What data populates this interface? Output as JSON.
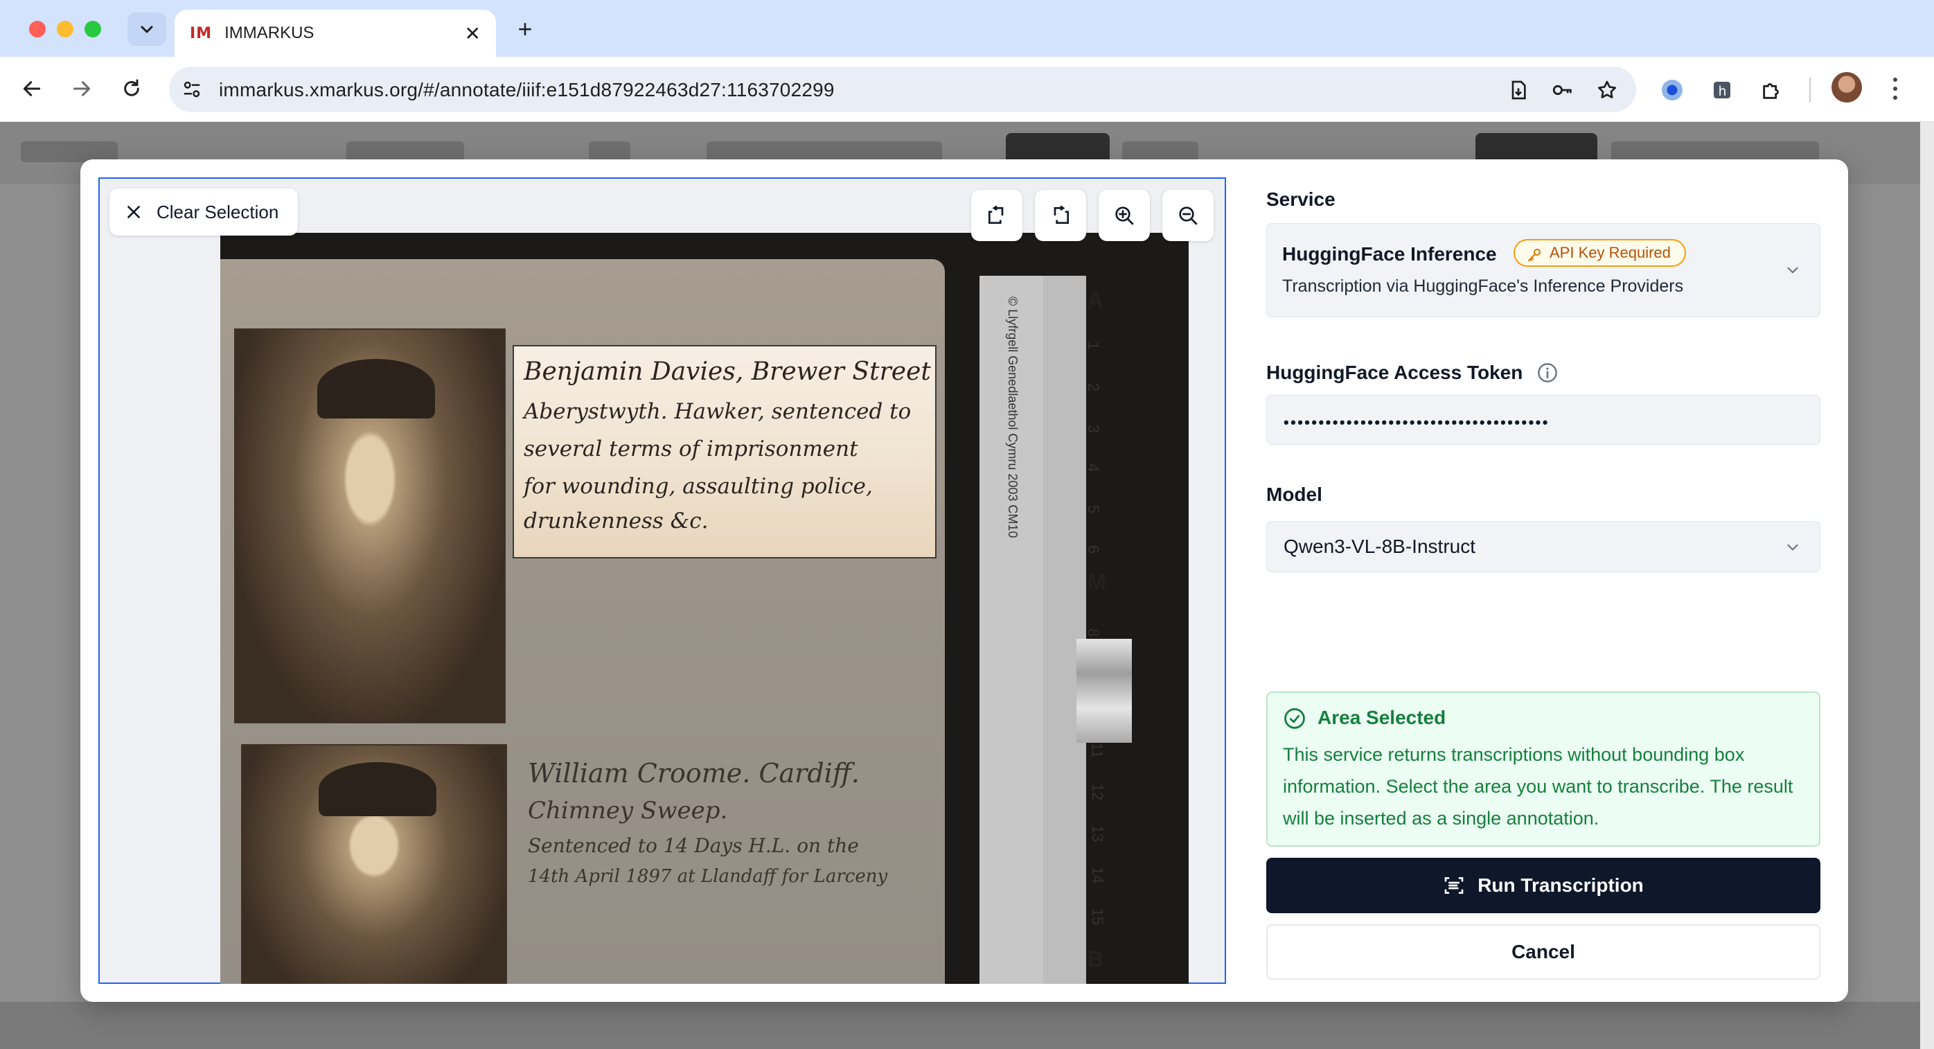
{
  "browser": {
    "tab_favicon": "IM",
    "tab_title": "IMMARKUS",
    "tab_close_glyph": "✕",
    "new_tab_glyph": "+",
    "url": "immarkus.xmarkus.org/#/annotate/iiif:e151d87922463d27:1163702299"
  },
  "viewer": {
    "clear_selection_label": "Clear Selection",
    "tools": [
      "rotate-left-icon",
      "rotate-right-icon",
      "zoom-in-icon",
      "zoom-out-icon"
    ]
  },
  "scan": {
    "entry1": [
      "Benjamin Davies, Brewer Street",
      "Aberystwyth. Hawker, sentenced to",
      "several terms of imprisonment",
      "for wounding, assaulting police,",
      "drunkenness &c."
    ],
    "entry2": [
      "William Croome. Cardiff.",
      "Chimney Sweep.",
      "Sentenced to 14 Days H.L. on the",
      "14th April 1897 at Llandaff for Larceny"
    ],
    "ruler_text": "© Llyfrgell Genedlaethol Cymru 2003   CM10",
    "ruler_numbers": [
      "1",
      "2",
      "3",
      "4",
      "5",
      "6",
      "8",
      "11",
      "12",
      "13",
      "14",
      "15"
    ],
    "ruler_letters": [
      "A",
      "M",
      "B"
    ]
  },
  "panel": {
    "service_label": "Service",
    "service_name": "HuggingFace Inference",
    "api_badge": "API Key Required",
    "service_desc": "Transcription via HuggingFace's Inference Providers",
    "token_label": "HuggingFace Access Token",
    "token_value": "••••••••••••••••••••••••••••••••••••••",
    "model_label": "Model",
    "model_value": "Qwen3-VL-8B-Instruct",
    "notice_title": "Area Selected",
    "notice_body": "This service returns transcriptions without bounding box information. Select the area you want to transcribe. The result will be inserted as a single annotation.",
    "run_label": "Run Transcription",
    "cancel_label": "Cancel"
  },
  "colors": {
    "primary_button": "#0f172a",
    "selection_border": "#2563eb",
    "notice_green": "#15803d",
    "badge_amber": "#f59e0b"
  }
}
